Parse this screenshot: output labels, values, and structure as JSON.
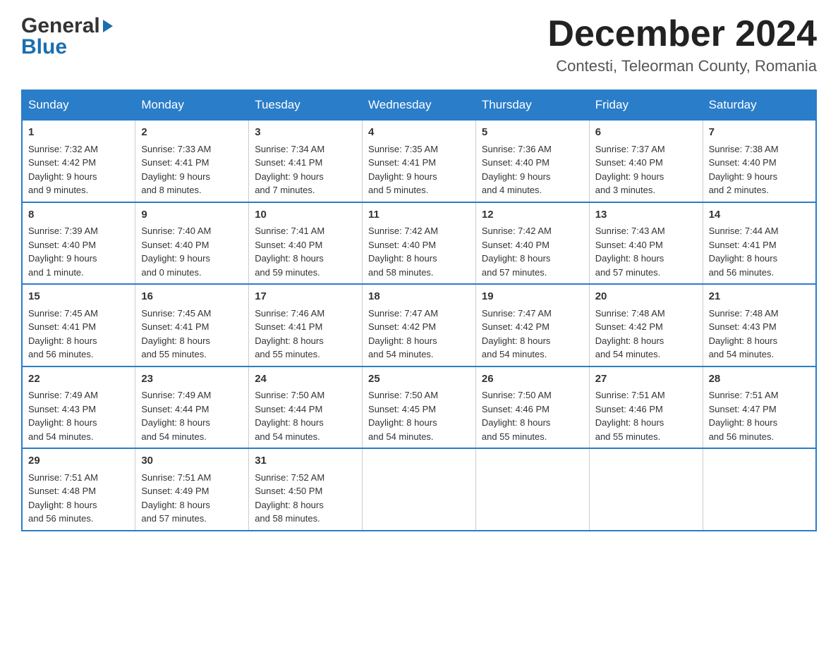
{
  "header": {
    "month_title": "December 2024",
    "location": "Contesti, Teleorman County, Romania",
    "logo_general": "General",
    "logo_blue": "Blue"
  },
  "days_of_week": [
    "Sunday",
    "Monday",
    "Tuesday",
    "Wednesday",
    "Thursday",
    "Friday",
    "Saturday"
  ],
  "weeks": [
    [
      {
        "day": "1",
        "sunrise": "7:32 AM",
        "sunset": "4:42 PM",
        "daylight": "9 hours and 9 minutes."
      },
      {
        "day": "2",
        "sunrise": "7:33 AM",
        "sunset": "4:41 PM",
        "daylight": "9 hours and 8 minutes."
      },
      {
        "day": "3",
        "sunrise": "7:34 AM",
        "sunset": "4:41 PM",
        "daylight": "9 hours and 7 minutes."
      },
      {
        "day": "4",
        "sunrise": "7:35 AM",
        "sunset": "4:41 PM",
        "daylight": "9 hours and 5 minutes."
      },
      {
        "day": "5",
        "sunrise": "7:36 AM",
        "sunset": "4:40 PM",
        "daylight": "9 hours and 4 minutes."
      },
      {
        "day": "6",
        "sunrise": "7:37 AM",
        "sunset": "4:40 PM",
        "daylight": "9 hours and 3 minutes."
      },
      {
        "day": "7",
        "sunrise": "7:38 AM",
        "sunset": "4:40 PM",
        "daylight": "9 hours and 2 minutes."
      }
    ],
    [
      {
        "day": "8",
        "sunrise": "7:39 AM",
        "sunset": "4:40 PM",
        "daylight": "9 hours and 1 minute."
      },
      {
        "day": "9",
        "sunrise": "7:40 AM",
        "sunset": "4:40 PM",
        "daylight": "9 hours and 0 minutes."
      },
      {
        "day": "10",
        "sunrise": "7:41 AM",
        "sunset": "4:40 PM",
        "daylight": "8 hours and 59 minutes."
      },
      {
        "day": "11",
        "sunrise": "7:42 AM",
        "sunset": "4:40 PM",
        "daylight": "8 hours and 58 minutes."
      },
      {
        "day": "12",
        "sunrise": "7:42 AM",
        "sunset": "4:40 PM",
        "daylight": "8 hours and 57 minutes."
      },
      {
        "day": "13",
        "sunrise": "7:43 AM",
        "sunset": "4:40 PM",
        "daylight": "8 hours and 57 minutes."
      },
      {
        "day": "14",
        "sunrise": "7:44 AM",
        "sunset": "4:41 PM",
        "daylight": "8 hours and 56 minutes."
      }
    ],
    [
      {
        "day": "15",
        "sunrise": "7:45 AM",
        "sunset": "4:41 PM",
        "daylight": "8 hours and 56 minutes."
      },
      {
        "day": "16",
        "sunrise": "7:45 AM",
        "sunset": "4:41 PM",
        "daylight": "8 hours and 55 minutes."
      },
      {
        "day": "17",
        "sunrise": "7:46 AM",
        "sunset": "4:41 PM",
        "daylight": "8 hours and 55 minutes."
      },
      {
        "day": "18",
        "sunrise": "7:47 AM",
        "sunset": "4:42 PM",
        "daylight": "8 hours and 54 minutes."
      },
      {
        "day": "19",
        "sunrise": "7:47 AM",
        "sunset": "4:42 PM",
        "daylight": "8 hours and 54 minutes."
      },
      {
        "day": "20",
        "sunrise": "7:48 AM",
        "sunset": "4:42 PM",
        "daylight": "8 hours and 54 minutes."
      },
      {
        "day": "21",
        "sunrise": "7:48 AM",
        "sunset": "4:43 PM",
        "daylight": "8 hours and 54 minutes."
      }
    ],
    [
      {
        "day": "22",
        "sunrise": "7:49 AM",
        "sunset": "4:43 PM",
        "daylight": "8 hours and 54 minutes."
      },
      {
        "day": "23",
        "sunrise": "7:49 AM",
        "sunset": "4:44 PM",
        "daylight": "8 hours and 54 minutes."
      },
      {
        "day": "24",
        "sunrise": "7:50 AM",
        "sunset": "4:44 PM",
        "daylight": "8 hours and 54 minutes."
      },
      {
        "day": "25",
        "sunrise": "7:50 AM",
        "sunset": "4:45 PM",
        "daylight": "8 hours and 54 minutes."
      },
      {
        "day": "26",
        "sunrise": "7:50 AM",
        "sunset": "4:46 PM",
        "daylight": "8 hours and 55 minutes."
      },
      {
        "day": "27",
        "sunrise": "7:51 AM",
        "sunset": "4:46 PM",
        "daylight": "8 hours and 55 minutes."
      },
      {
        "day": "28",
        "sunrise": "7:51 AM",
        "sunset": "4:47 PM",
        "daylight": "8 hours and 56 minutes."
      }
    ],
    [
      {
        "day": "29",
        "sunrise": "7:51 AM",
        "sunset": "4:48 PM",
        "daylight": "8 hours and 56 minutes."
      },
      {
        "day": "30",
        "sunrise": "7:51 AM",
        "sunset": "4:49 PM",
        "daylight": "8 hours and 57 minutes."
      },
      {
        "day": "31",
        "sunrise": "7:52 AM",
        "sunset": "4:50 PM",
        "daylight": "8 hours and 58 minutes."
      },
      null,
      null,
      null,
      null
    ]
  ],
  "labels": {
    "sunrise": "Sunrise:",
    "sunset": "Sunset:",
    "daylight": "Daylight:"
  }
}
